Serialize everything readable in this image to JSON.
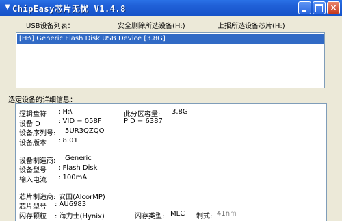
{
  "window": {
    "title": "ChipEasy芯片无忧 V1.4.8",
    "sys_icon": "down-triangle-icon",
    "close_glyph": "×"
  },
  "toolbar": {
    "device_list_label": "USB设备列表：",
    "safe_remove_label": "安全删除所选设备(H:)",
    "report_chip_label": "上报所选设备芯片(H:)"
  },
  "device_list": {
    "items": [
      "[H:\\] Generic Flash Disk USB Device [3.8G]"
    ],
    "selected_index": 0
  },
  "details": {
    "heading": "选定设备的详细信息：",
    "drive_letter_label": "逻辑盘符",
    "drive_letter_value": ": H:\\",
    "capacity_label": "此分区容量:",
    "capacity_value": "3.8G",
    "device_id_label": "设备ID",
    "vid": ": VID = 058F",
    "pid": "PID = 6387",
    "serial_label": "设备序列号:",
    "serial_value": "5UR3QZQO",
    "version_label": "设备版本",
    "version_value": ": 8.01",
    "manufacturer_label": "设备制造商:",
    "manufacturer_value": "Generic",
    "model_label": "设备型号",
    "model_value": ": Flash Disk",
    "current_label": "输入电流",
    "current_value": ": 100mA",
    "chip_maker_label": "芯片制造商:",
    "chip_maker_value": "安国(AlcorMP)",
    "chip_model_label": "芯片型号",
    "chip_model_value": ": AU6983",
    "flash_label": "闪存颗粒",
    "flash_value": ": 海力士(Hynix)",
    "flash_type_label": "闪存类型:",
    "flash_type_value": "MLC",
    "process_label": "制式:",
    "process_value": "41nm"
  }
}
